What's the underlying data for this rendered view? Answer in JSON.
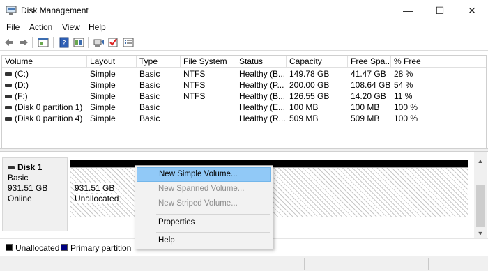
{
  "window": {
    "title": "Disk Management",
    "minimize_glyph": "—",
    "maximize_glyph": "☐",
    "close_glyph": "✕"
  },
  "menu": [
    "File",
    "Action",
    "View",
    "Help"
  ],
  "toolbar": [
    "back-arrow-icon",
    "forward-arrow-icon",
    "show-hide-console-tree-icon",
    "help-icon",
    "properties-icon",
    "connect-icon",
    "check-icon",
    "list-icon"
  ],
  "columns": [
    "Volume",
    "Layout",
    "Type",
    "File System",
    "Status",
    "Capacity",
    "Free Spa...",
    "% Free"
  ],
  "volumes": [
    {
      "volume": "(C:)",
      "layout": "Simple",
      "type": "Basic",
      "fs": "NTFS",
      "status": "Healthy (B...",
      "capacity": "149.78 GB",
      "free": "41.47 GB",
      "pct": "28 %"
    },
    {
      "volume": "(D:)",
      "layout": "Simple",
      "type": "Basic",
      "fs": "NTFS",
      "status": "Healthy (P...",
      "capacity": "200.00 GB",
      "free": "108.64 GB",
      "pct": "54 %"
    },
    {
      "volume": "(F:)",
      "layout": "Simple",
      "type": "Basic",
      "fs": "NTFS",
      "status": "Healthy (B...",
      "capacity": "126.55 GB",
      "free": "14.20 GB",
      "pct": "11 %"
    },
    {
      "volume": "(Disk 0 partition 1)",
      "layout": "Simple",
      "type": "Basic",
      "fs": "",
      "status": "Healthy (E...",
      "capacity": "100 MB",
      "free": "100 MB",
      "pct": "100 %"
    },
    {
      "volume": "(Disk 0 partition 4)",
      "layout": "Simple",
      "type": "Basic",
      "fs": "",
      "status": "Healthy (R...",
      "capacity": "509 MB",
      "free": "509 MB",
      "pct": "100 %"
    }
  ],
  "disk": {
    "name": "Disk 1",
    "type": "Basic",
    "size": "931.51 GB",
    "state": "Online",
    "region_size": "931.51 GB",
    "region_label": "Unallocated"
  },
  "legend": [
    {
      "label": "Unallocated",
      "color": "#000000"
    },
    {
      "label": "Primary partition",
      "color": "#000080"
    }
  ],
  "context_menu": {
    "items": [
      {
        "label": "New Simple Volume...",
        "state": "hover"
      },
      {
        "label": "New Spanned Volume...",
        "state": "disabled"
      },
      {
        "label": "New Striped Volume...",
        "state": "disabled"
      },
      {
        "label": "Properties",
        "state": "enabled"
      },
      {
        "label": "Help",
        "state": "enabled"
      }
    ]
  },
  "colors": {
    "accent_hover": "#91c9f7",
    "primary_partition": "#000080"
  }
}
